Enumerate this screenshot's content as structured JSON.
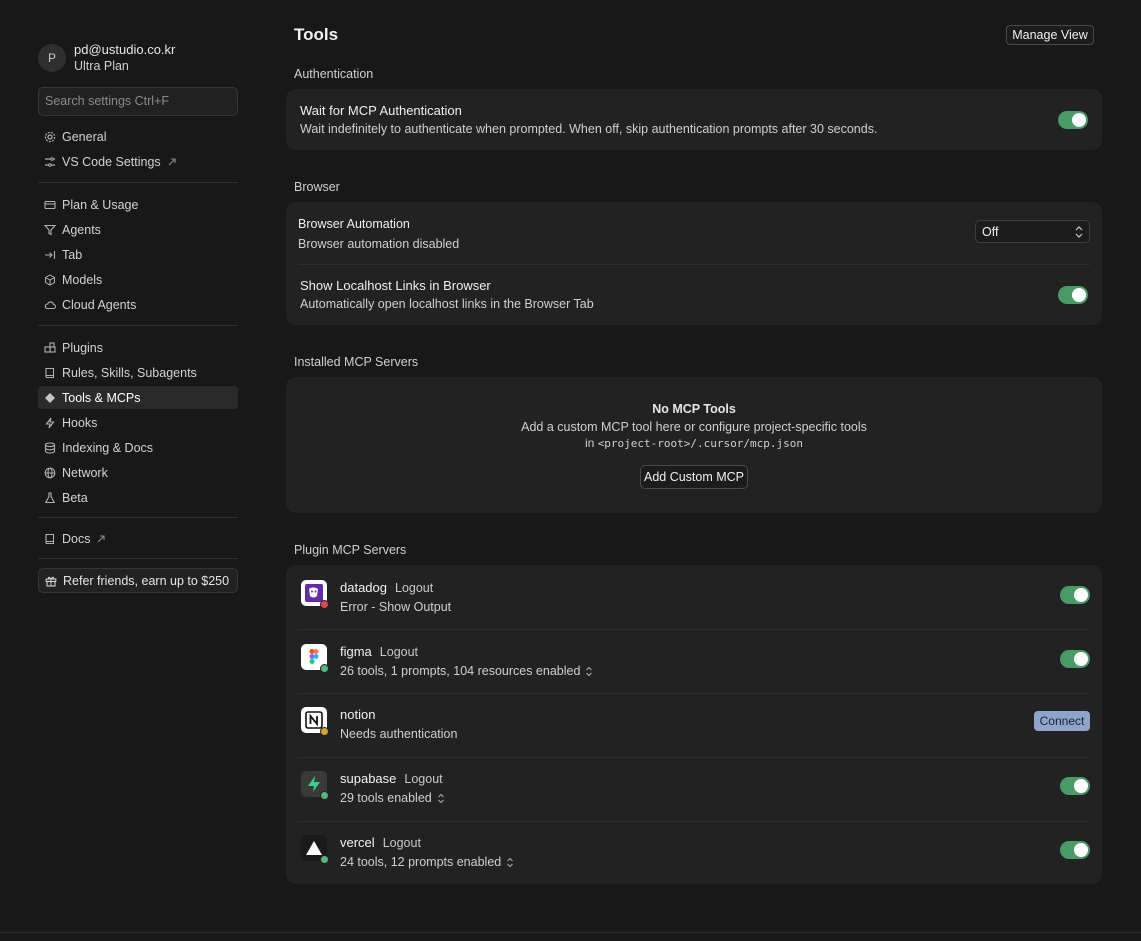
{
  "user": {
    "avatar_letter": "P",
    "email": "pd@ustudio.co.kr",
    "plan": "Ultra Plan"
  },
  "search": {
    "placeholder": "Search settings Ctrl+F"
  },
  "sidebar": {
    "items": [
      {
        "label": "General",
        "icon": "gear-icon"
      },
      {
        "label": "VS Code Settings",
        "icon": "vscode-settings-icon"
      },
      {
        "label": "Plan & Usage",
        "icon": "card-icon"
      },
      {
        "label": "Agents",
        "icon": "agents-icon"
      },
      {
        "label": "Tab",
        "icon": "tab-arrow-icon"
      },
      {
        "label": "Models",
        "icon": "cube-icon"
      },
      {
        "label": "Cloud Agents",
        "icon": "cloud-icon"
      },
      {
        "label": "Plugins",
        "icon": "plugins-icon"
      },
      {
        "label": "Rules, Skills, Subagents",
        "icon": "book-icon"
      },
      {
        "label": "Tools & MCPs",
        "icon": "tools-icon"
      },
      {
        "label": "Hooks",
        "icon": "bolt-icon"
      },
      {
        "label": "Indexing & Docs",
        "icon": "database-icon"
      },
      {
        "label": "Network",
        "icon": "globe-icon"
      },
      {
        "label": "Beta",
        "icon": "flask-icon"
      },
      {
        "label": "Docs",
        "icon": "book-icon"
      }
    ],
    "active": "Tools & MCPs",
    "refer_label": "Refer friends, earn up to $250"
  },
  "main": {
    "title": "Tools",
    "manage_view": "Manage View",
    "auth": {
      "section": "Authentication",
      "title": "Wait for MCP Authentication",
      "desc": "Wait indefinitely to authenticate when prompted. When off, skip authentication prompts after 30 seconds.",
      "enabled": true
    },
    "browser": {
      "section": "Browser",
      "automation_title": "Browser Automation",
      "automation_desc": "Browser automation disabled",
      "automation_value": "Off",
      "localhost_title": "Show Localhost Links in Browser",
      "localhost_desc": "Automatically open localhost links in the Browser Tab",
      "localhost_enabled": true
    },
    "installed": {
      "section": "Installed MCP Servers",
      "empty_title": "No MCP Tools",
      "empty_desc": "Add a custom MCP tool here or configure project-specific tools",
      "empty_path_prefix": "in",
      "empty_path": "<project-root>/.cursor/mcp.json",
      "add_button": "Add Custom MCP"
    },
    "plugin": {
      "section": "Plugin MCP Servers",
      "servers": [
        {
          "name": "datadog",
          "action": "Logout",
          "status": "Error - Show Output",
          "dot": "#e0484e",
          "enabled": true
        },
        {
          "name": "figma",
          "action": "Logout",
          "status": "26 tools, 1 prompts, 104 resources enabled",
          "dot": "#55b57a",
          "enabled": true
        },
        {
          "name": "notion",
          "action": "",
          "status": "Needs authentication",
          "dot": "#d4a62a",
          "connect": "Connect"
        },
        {
          "name": "supabase",
          "action": "Logout",
          "status": "29 tools enabled",
          "dot": "#55b57a",
          "enabled": true
        },
        {
          "name": "vercel",
          "action": "Logout",
          "status": "24 tools, 12 prompts enabled",
          "dot": "#55b57a",
          "enabled": true
        }
      ]
    }
  },
  "colors": {
    "toggle_on": "#4a9a68",
    "background": "#181818",
    "card": "#222222",
    "connect": "#8ea4c9"
  }
}
